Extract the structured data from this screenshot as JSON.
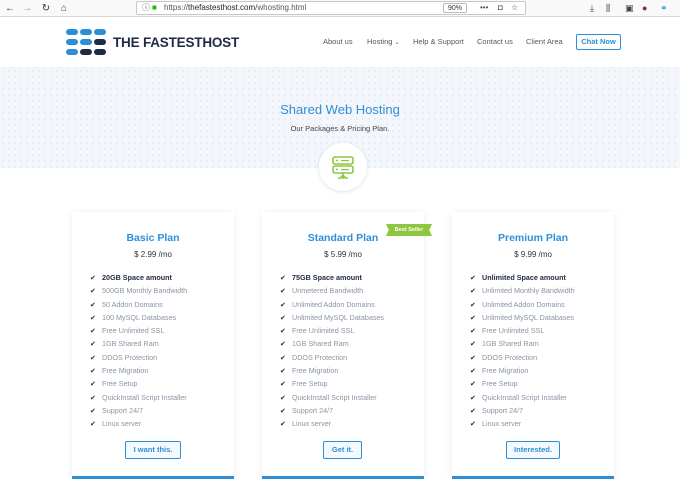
{
  "browser": {
    "back_icon": "back-arrow",
    "forward_icon": "forward-arrow",
    "reload_icon": "reload",
    "home_icon": "home",
    "url_prefix": "https://",
    "url_host": "thefastesthost.com",
    "url_path": "/whosting.html",
    "zoom": "90%"
  },
  "header": {
    "logo_the": "THE ",
    "logo_fastest": "FASTEST",
    "logo_host": "HOST",
    "nav": [
      "About us",
      "Hosting",
      "Help & Support",
      "Contact us",
      "Client Area"
    ],
    "hosting_caret": "⌄",
    "cta": "Chat Now"
  },
  "hero": {
    "title": "Shared Web Hosting",
    "subtitle": "Our Packages & Pricing Plan."
  },
  "plans": [
    {
      "name": "Basic Plan",
      "price": "$ 2.99 /mo",
      "features": [
        "20GB Space amount",
        "500GB Monthly Bandwidth",
        "50 Addon Domains",
        "100 MySQL Databases",
        "Free Unlimited SSL",
        "1GB Shared Ram",
        "DDOS Protection",
        "Free Migration",
        "Free Setup",
        "QuickInstall Script Installer",
        "Support 24/7",
        "Linux server"
      ],
      "button": "I want this."
    },
    {
      "name": "Standard Plan",
      "price": "$ 5.99 /mo",
      "badge": "Best Seller",
      "features": [
        "75GB Space amount",
        "Unmetered Bandwidth",
        "Unlimited Addon Domains",
        "Unlimited MySQL Databases",
        "Free Unlimited SSL",
        "1GB Shared Ram",
        "DDOS Protection",
        "Free Migration",
        "Free Setup",
        "QuickInstall Script Installer",
        "Support 24/7",
        "Linux server"
      ],
      "button": "Get it."
    },
    {
      "name": "Premium Plan",
      "price": "$ 9.99 /mo",
      "features": [
        "Unlimited Space amount",
        "Unlimited Monthly Bandwidth",
        "Unlimited Addon Domains",
        "Unlimited MySQL Databases",
        "Free Unlimited SSL",
        "1GB Shared Ram",
        "DDOS Protection",
        "Free Migration",
        "Free Setup",
        "QuickInstall Script Installer",
        "Support 24/7",
        "Linux server"
      ],
      "button": "Interested."
    }
  ],
  "colors": {
    "accent": "#2c8fd6",
    "badge": "#8dc63f",
    "dark": "#1f2a44"
  }
}
